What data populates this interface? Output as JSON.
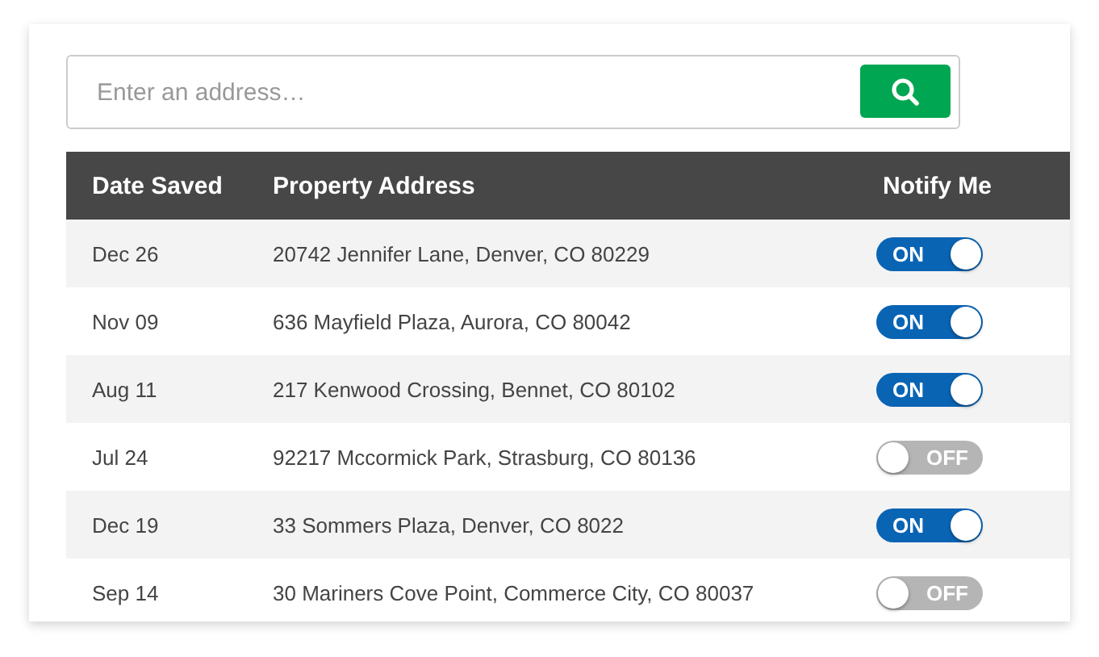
{
  "search": {
    "placeholder": "Enter an address…"
  },
  "table": {
    "columns": [
      "Date Saved",
      "Property Address",
      "Notify Me"
    ],
    "rows": [
      {
        "date": "Dec 26",
        "address": "20742 Jennifer Lane, Denver, CO 80229",
        "notify": {
          "on": true,
          "label": "ON"
        }
      },
      {
        "date": "Nov 09",
        "address": "636 Mayfield Plaza, Aurora, CO 80042",
        "notify": {
          "on": true,
          "label": "ON"
        }
      },
      {
        "date": "Aug 11",
        "address": "217 Kenwood Crossing, Bennet, CO 80102",
        "notify": {
          "on": true,
          "label": "ON"
        }
      },
      {
        "date": "Jul 24",
        "address": "92217 Mccormick Park, Strasburg, CO 80136",
        "notify": {
          "on": false,
          "label": "OFF"
        }
      },
      {
        "date": "Dec 19",
        "address": "33 Sommers Plaza, Denver, CO 8022",
        "notify": {
          "on": true,
          "label": "ON"
        }
      },
      {
        "date": "Sep 14",
        "address": "30 Mariners Cove Point, Commerce City, CO 80037",
        "notify": {
          "on": false,
          "label": "OFF"
        }
      }
    ]
  }
}
